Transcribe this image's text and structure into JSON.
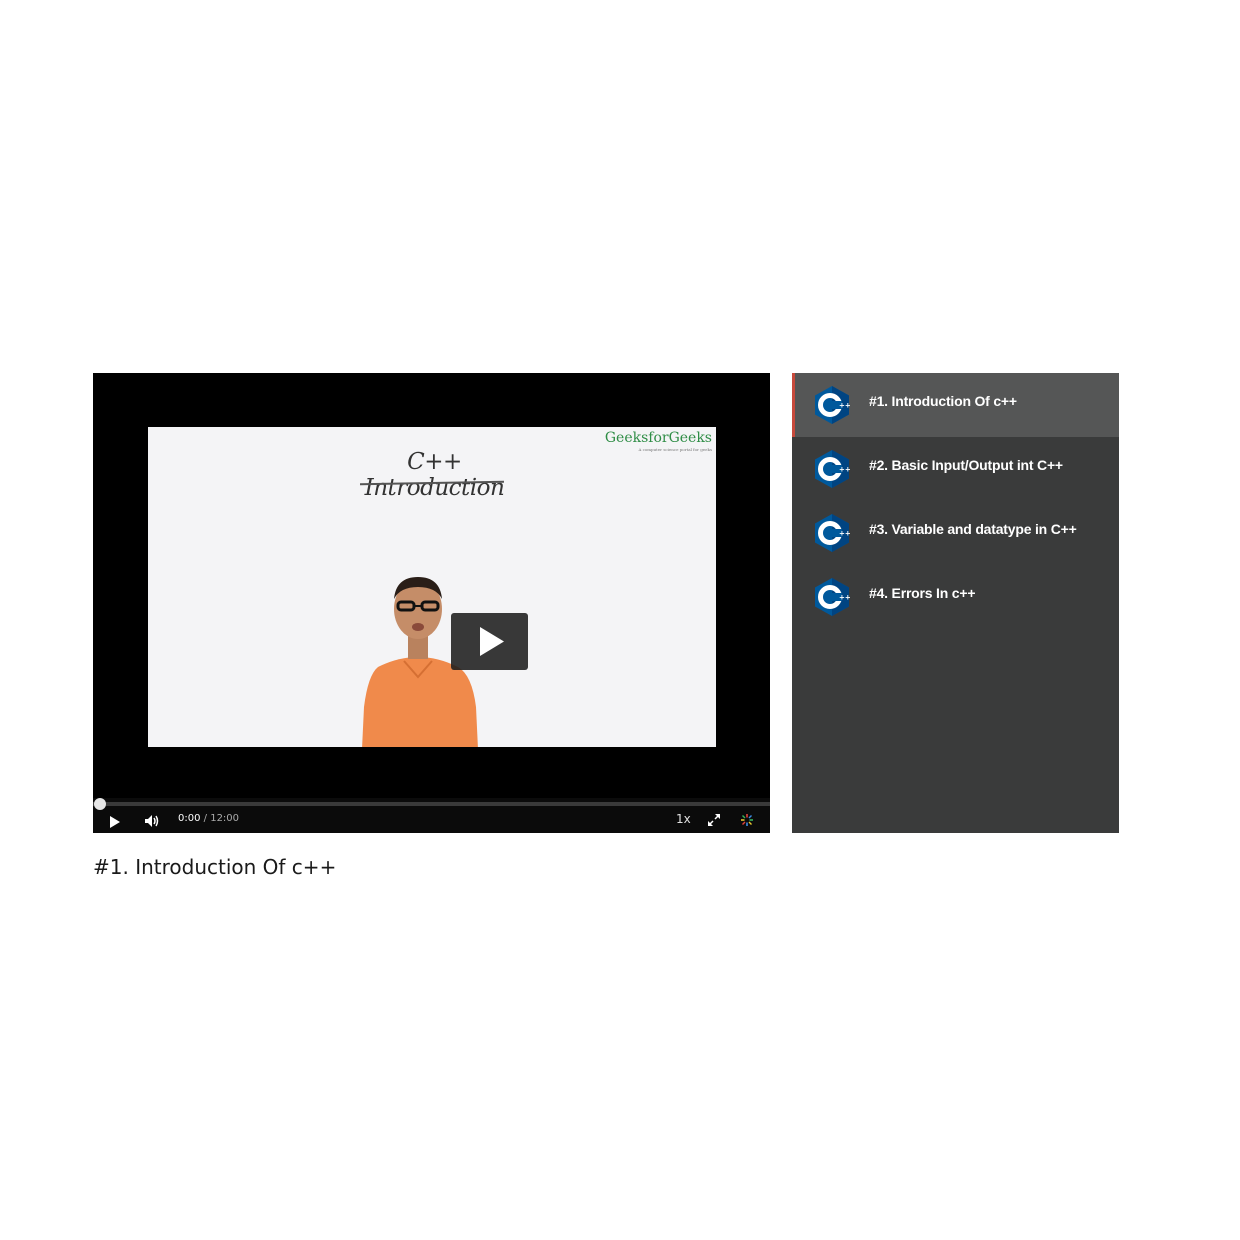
{
  "player": {
    "whiteboard_text": "C++ Introduction",
    "logo_text": "GeeksforGeeks",
    "logo_tagline": "A computer science portal for geeks",
    "current_time": "0:00",
    "duration": "/ 12:00",
    "progress": 0.0,
    "speed_label": "1x",
    "icons": {
      "big_play": "play-icon",
      "play": "play-icon",
      "volume": "volume-icon",
      "fullscreen": "fullscreen-icon",
      "brand": "spark-logo-icon"
    }
  },
  "playlist": {
    "items": [
      {
        "label": "#1. Introduction Of c++",
        "active": true
      },
      {
        "label": "#2. Basic Input/Output int C++",
        "active": false
      },
      {
        "label": "#3. Variable and datatype in C++",
        "active": false
      },
      {
        "label": "#4. Errors In c++",
        "active": false
      }
    ],
    "icon": "cpp-logo-icon"
  },
  "video_title": "#1. Introduction Of c++",
  "colors": {
    "playlist_bg": "#3a3b3b",
    "playlist_active_bg": "#555656",
    "active_marker": "#c74a3c",
    "cpp_blue": "#00599c",
    "brand_green": "#2f8d46"
  }
}
